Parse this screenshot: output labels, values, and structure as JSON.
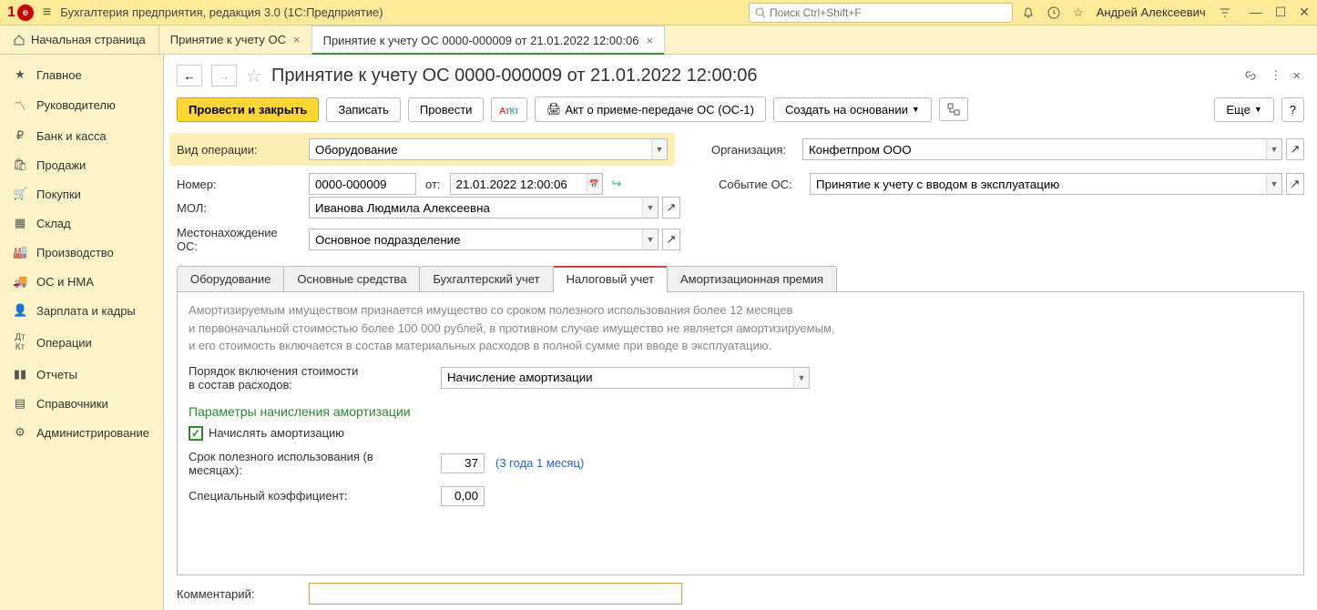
{
  "titlebar": {
    "app_title": "Бухгалтерия предприятия, редакция 3.0  (1С:Предприятие)",
    "search_placeholder": "Поиск Ctrl+Shift+F",
    "username": "Андрей Алексеевич"
  },
  "tabs": {
    "home": "Начальная страница",
    "t1": "Принятие к учету ОС",
    "t2": "Принятие к учету ОС 0000-000009 от 21.01.2022 12:00:06"
  },
  "sidebar": {
    "items": [
      "Главное",
      "Руководителю",
      "Банк и касса",
      "Продажи",
      "Покупки",
      "Склад",
      "Производство",
      "ОС и НМА",
      "Зарплата и кадры",
      "Операции",
      "Отчеты",
      "Справочники",
      "Администрирование"
    ]
  },
  "doc": {
    "title": "Принятие к учету ОС 0000-000009 от 21.01.2022 12:00:06"
  },
  "toolbar": {
    "post_close": "Провести и закрыть",
    "save": "Записать",
    "post": "Провести",
    "print_act": "Акт о приеме-передаче ОС (ОС-1)",
    "create_based": "Создать на основании",
    "more": "Еще"
  },
  "form": {
    "op_type_label": "Вид операции:",
    "op_type_value": "Оборудование",
    "number_label": "Номер:",
    "number_value": "0000-000009",
    "from_label": "от:",
    "date_value": "21.01.2022 12:00:06",
    "org_label": "Организация:",
    "org_value": "Конфетпром ООО",
    "event_label": "Событие ОС:",
    "event_value": "Принятие к учету с вводом в эксплуатацию",
    "mol_label": "МОЛ:",
    "mol_value": "Иванова Людмила Алексеевна",
    "loc_label": "Местонахождение ОС:",
    "loc_value": "Основное подразделение",
    "comment_label": "Комментарий:",
    "comment_value": ""
  },
  "inner_tabs": {
    "t1": "Оборудование",
    "t2": "Основные средства",
    "t3": "Бухгалтерский учет",
    "t4": "Налоговый учет",
    "t5": "Амортизационная премия"
  },
  "tax": {
    "hint1": "Амортизируемым имуществом признается имущество со сроком полезного использования более 12 месяцев",
    "hint2": "и первоначальной стоимостью более 100 000 рублей, в противном случае имущество не является амортизируемым,",
    "hint3": "и его стоимость включается в состав материальных расходов в полной сумме при вводе в эксплуатацию.",
    "order_label1": "Порядок включения стоимости",
    "order_label2": "в состав расходов:",
    "order_value": "Начисление амортизации",
    "section_title": "Параметры начисления амортизации",
    "chk_label": "Начислять амортизацию",
    "life_label": "Срок полезного использования (в месяцах):",
    "life_value": "37",
    "life_hint": "(3 года 1 месяц)",
    "coef_label": "Специальный коэффициент:",
    "coef_value": "0,00"
  }
}
